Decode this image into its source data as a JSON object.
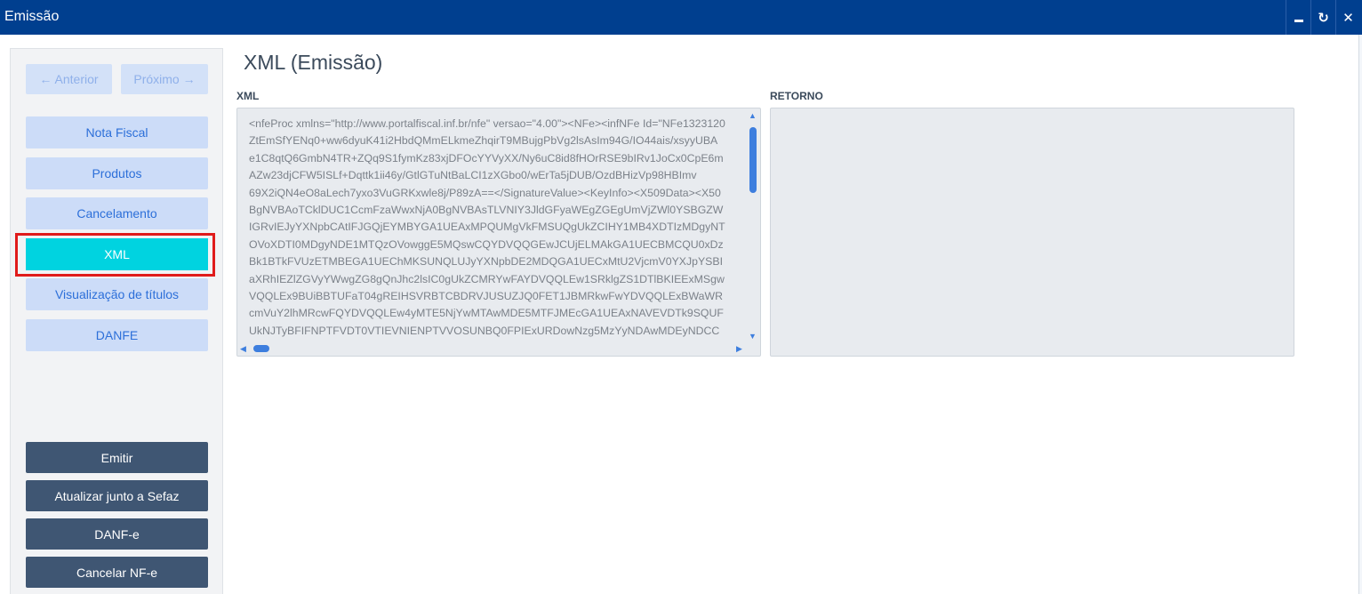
{
  "window": {
    "title": "Emissão",
    "close_glyph": "✕",
    "restore_glyph": "↻"
  },
  "sidebar": {
    "nav": {
      "previous": "← Anterior",
      "next": "Próximo →"
    },
    "tabs": [
      {
        "label": "Nota Fiscal"
      },
      {
        "label": "Produtos"
      },
      {
        "label": "Cancelamento"
      },
      {
        "label": "XML",
        "active": true
      },
      {
        "label": "Visualização de títulos"
      },
      {
        "label": "DANFE"
      }
    ],
    "actions": [
      {
        "label": "Emitir"
      },
      {
        "label": "Atualizar junto a Sefaz"
      },
      {
        "label": "DANF-e"
      },
      {
        "label": "Cancelar NF-e"
      }
    ]
  },
  "main": {
    "title": "XML (Emissão)",
    "xml_label": "XML",
    "retorno_label": "RETORNO",
    "xml_lines": [
      "<nfeProc xmlns=\"http://www.portalfiscal.inf.br/nfe\" versao=\"4.00\"><NFe><infNFe Id=\"NFe1323120",
      "ZtEmSfYENq0+ww6dyuK41i2HbdQMmELkmeZhqirT9MBujgPbVg2lsAsIm94G/IO44ais/xsyyUBA",
      "e1C8qtQ6GmbN4TR+ZQq9S1fymKz83xjDFOcYYVyXX/Ny6uC8id8fHOrRSE9bIRv1JoCx0CpE6m",
      "AZw23djCFW5ISLf+Dqttk1ii46y/GtlGTuNtBaLCI1zXGbo0/wErTa5jDUB/OzdBHizVp98HBImv",
      "69X2iQN4eO8aLech7yxo3VuGRKxwle8j/P89zA==</SignatureValue><KeyInfo><X509Data><X50",
      "BgNVBAoTCklDUC1CcmFzaWwxNjA0BgNVBAsTLVNIY3JldGFyaWEgZGEgUmVjZWl0YSBGZW",
      "IGRvIEJyYXNpbCAtIFJGQjEYMBYGA1UEAxMPQUMgVkFMSUQgUkZCIHY1MB4XDTIzMDgyNT",
      "OVoXDTI0MDgyNDE1MTQzOVowggE5MQswCQYDVQQGEwJCUjELMAkGA1UECBMCQU0xDz",
      "Bk1BTkFVUzETMBEGA1UEChMKSUNQLUJyYXNpbDE2MDQGA1UECxMtU2VjcmV0YXJpYSBI",
      "aXRhIEZlZGVyYWwgZG8gQnJhc2lsIC0gUkZCMRYwFAYDVQQLEw1SRklgZS1DTlBKIEExMSgw",
      "VQQLEx9BUiBBTUFaT04gREIHSVRBTCBDRVJUSUZJQ0FET1JBMRkwFwYDVQQLExBWaWR",
      "cmVuY2lhMRcwFQYDVQQLEw4yMTE5NjYwMTAwMDE5MTFJMEcGA1UEAxNAVEVDTk9SQUF",
      "UkNJTyBFIFNPTFVDT0VTIEVNIENPTVVOSUNBQ0FPIExURDowNzg5MzYyNDAwMDEyNDCC"
    ]
  }
}
